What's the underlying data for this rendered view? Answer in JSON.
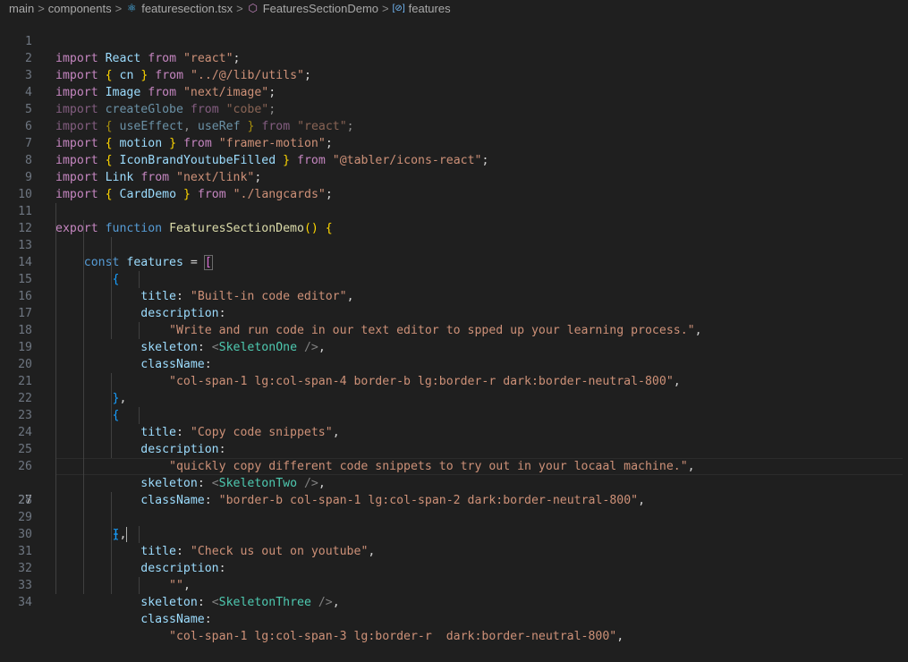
{
  "breadcrumb": {
    "items": [
      "main",
      "components",
      "featuresection.tsx",
      "FeaturesSectionDemo",
      "features"
    ],
    "separator": ">"
  },
  "editor": {
    "active_line": 27,
    "lines": [
      {
        "n": "1"
      },
      {
        "n": "2"
      },
      {
        "n": "3"
      },
      {
        "n": "4"
      },
      {
        "n": "5"
      },
      {
        "n": "6"
      },
      {
        "n": "7"
      },
      {
        "n": "8"
      },
      {
        "n": "9"
      },
      {
        "n": "10"
      },
      {
        "n": "11"
      },
      {
        "n": "12"
      },
      {
        "n": "13"
      },
      {
        "n": "14"
      },
      {
        "n": "15"
      },
      {
        "n": "16"
      },
      {
        "n": "17"
      },
      {
        "n": "18"
      },
      {
        "n": "19"
      },
      {
        "n": "20"
      },
      {
        "n": "21"
      },
      {
        "n": "22"
      },
      {
        "n": "23"
      },
      {
        "n": "24"
      },
      {
        "n": "25"
      },
      {
        "n": "26"
      },
      {
        "n": "27"
      },
      {
        "n": "28"
      },
      {
        "n": "29"
      },
      {
        "n": "30"
      },
      {
        "n": "31"
      },
      {
        "n": "32"
      },
      {
        "n": "33"
      },
      {
        "n": "34"
      }
    ],
    "tokens": {
      "import": "import",
      "from": "from",
      "export": "export",
      "function": "function",
      "const": "const",
      "React": "React",
      "react_str": "\"react\"",
      "cn": "cn",
      "utils_str": "\"../@/lib/utils\"",
      "Image": "Image",
      "image_str": "\"next/image\"",
      "createGlobe": "createGlobe",
      "cobe_str": "\"cobe\"",
      "useEffect": "useEffect",
      "useRef": "useRef",
      "motion": "motion",
      "framer_str": "\"framer-motion\"",
      "IconBrandYoutubeFilled": "IconBrandYoutubeFilled",
      "tabler_str": "\"@tabler/icons-react\"",
      "Link": "Link",
      "link_str": "\"next/link\"",
      "CardDemo": "CardDemo",
      "langcards_str": "\"./langcards\"",
      "FeaturesSectionDemo": "FeaturesSectionDemo",
      "features": "features",
      "title": "title",
      "description": "description",
      "skeleton": "skeleton",
      "className": "className",
      "title1": "\"Built-in code editor\"",
      "desc1": "\"Write and run code in our text editor to spped up your learning process.\"",
      "SkeletonOne": "SkeletonOne",
      "class1": "\"col-span-1 lg:col-span-4 border-b lg:border-r dark:border-neutral-800\"",
      "title2": "\"Copy code snippets\"",
      "desc2": "\"quickly copy different code snippets to try out in your locaal machine.\"",
      "SkeletonTwo": "SkeletonTwo",
      "class2": "\"border-b col-span-1 lg:col-span-2 dark:border-neutral-800\"",
      "title3": "\"Check us out on youtube\"",
      "desc3": "\"\"",
      "SkeletonThree": "SkeletonThree",
      "class3": "\"col-span-1 lg:col-span-3 lg:border-r  dark:border-neutral-800\""
    }
  },
  "colors": {
    "background": "#1f1f1f",
    "keyword": "#c586c0",
    "storage": "#569cd6",
    "identifier": "#9cdcfe",
    "function": "#dcdcaa",
    "string": "#ce9178",
    "jsx_tag": "#4ec9b0",
    "line_number": "#6e7681"
  }
}
